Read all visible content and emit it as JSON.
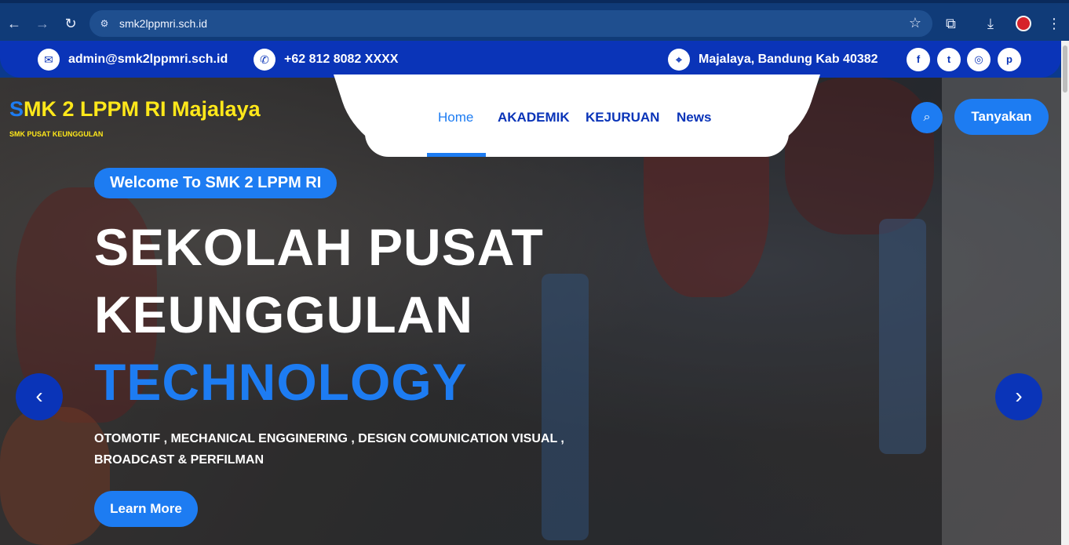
{
  "browser": {
    "url": "smk2lppmri.sch.id",
    "back_icon": "←",
    "forward_icon": "→",
    "reload_icon": "↻",
    "site_info_icon": "⚙",
    "star_icon": "☆",
    "extensions_icon": "⧉",
    "download_icon": "⤓",
    "menu_icon": "⋮"
  },
  "contact": {
    "email": "admin@smk2lppmri.sch.id",
    "phone": "+62 812 8082 XXXX",
    "address": "Majalaya, Bandung Kab 40382",
    "email_icon": "✉",
    "phone_icon": "✆",
    "location_icon": "⌖"
  },
  "social": {
    "facebook": "f",
    "twitter": "t",
    "instagram": "◎",
    "pinterest": "p"
  },
  "brand": {
    "logo_first": "S",
    "logo_rest": "MK 2 LPPM RI Majalaya",
    "tagline": "SMK PUSAT KEUNGGULAN"
  },
  "nav": {
    "items": [
      "Home",
      "AKADEMIK",
      "KEJURUAN",
      "News"
    ],
    "search_icon": "⌕",
    "ask_label": "Tanyakan"
  },
  "hero": {
    "welcome": "Welcome To SMK 2 LPPM RI",
    "line1": "SEKOLAH PUSAT",
    "line2": "KEUNGGULAN",
    "line3": "TECHNOLOGY",
    "subtitle": "OTOMOTIF , MECHANICAL ENGGINERING , DESIGN COMUNICATION VISUAL , BROADCAST & PERFILMAN",
    "cta": "Learn More",
    "prev_icon": "‹",
    "next_icon": "›"
  },
  "colors": {
    "primary": "#1d7cf2",
    "navy": "#0a34b8",
    "brand_yellow": "#ffe81a"
  }
}
